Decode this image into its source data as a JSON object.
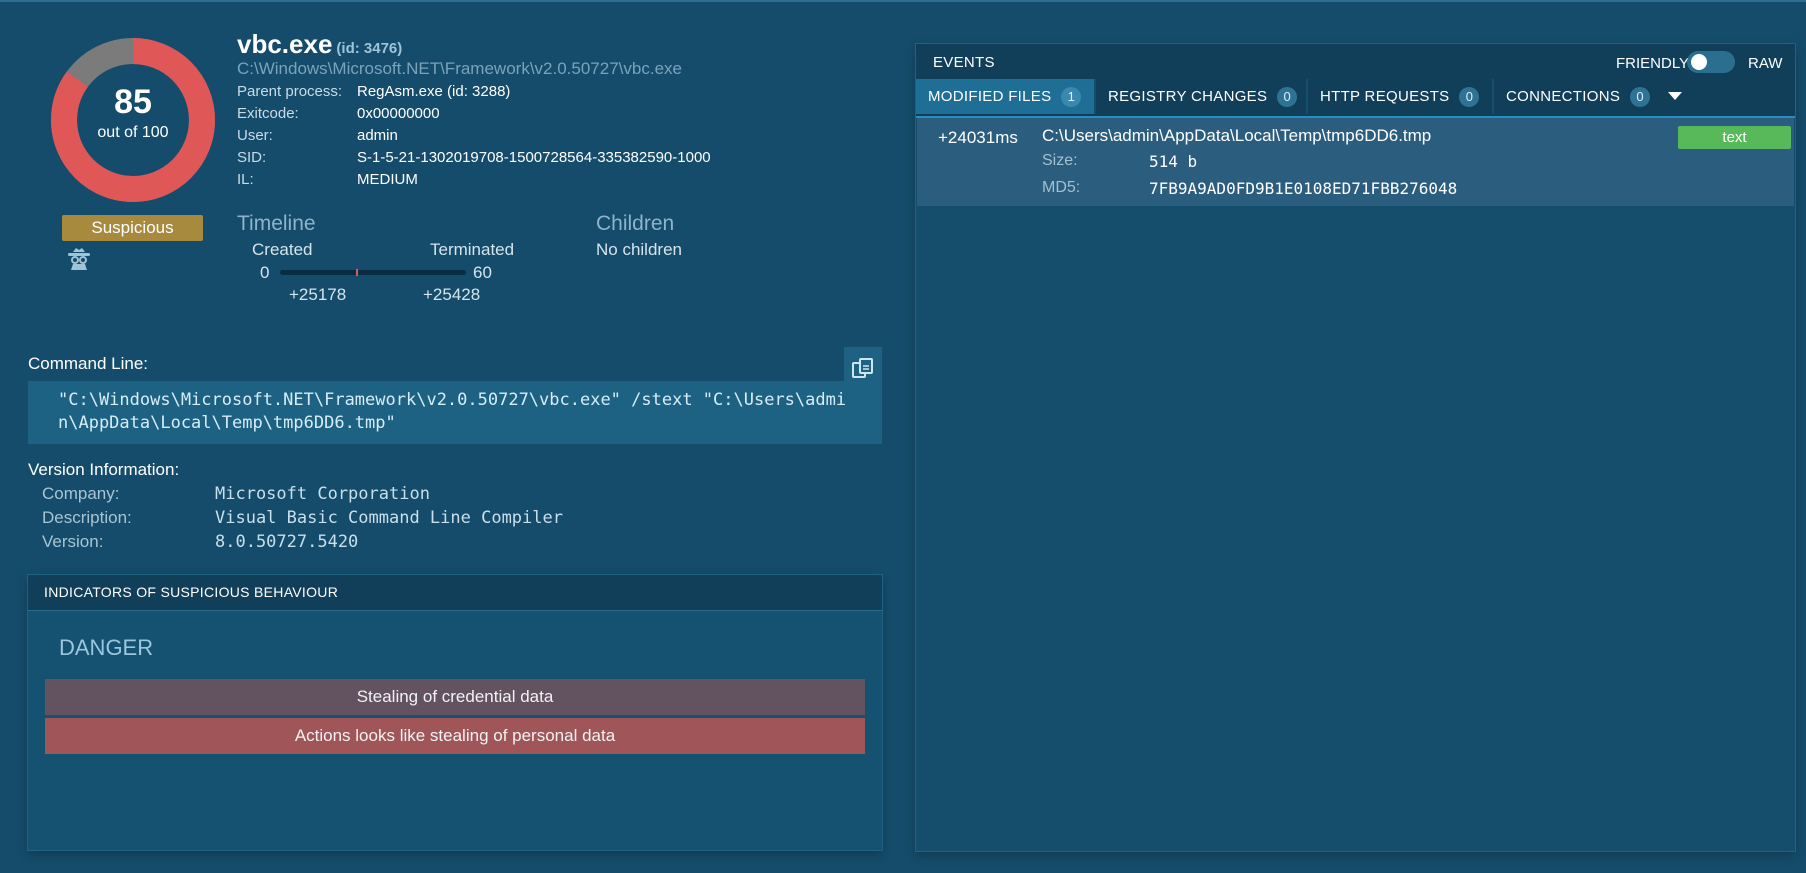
{
  "process": {
    "name": "vbc.exe",
    "id_label": "(id: 3476)",
    "path": "C:\\Windows\\Microsoft.NET\\Framework\\v2.0.50727\\vbc.exe",
    "info": [
      {
        "key": "Parent process:",
        "value": "RegAsm.exe (id: 3288)"
      },
      {
        "key": "Exitcode:",
        "value": "0x00000000"
      },
      {
        "key": "User:",
        "value": "admin"
      },
      {
        "key": "SID:",
        "value": "S-1-5-21-1302019708-1500728564-335382590-1000"
      },
      {
        "key": "IL:",
        "value": "MEDIUM"
      }
    ]
  },
  "score": {
    "value": "85",
    "out_of_label": "out of 100",
    "fraction": 0.85,
    "verdict": "Suspicious",
    "colors": {
      "danger": "#e05757",
      "rest": "#7b7b7b",
      "verdict": "#a88a3f"
    }
  },
  "timeline": {
    "title": "Timeline",
    "created_label": "Created",
    "terminated_label": "Terminated",
    "start": "0",
    "end": "60",
    "created_time": "+25178",
    "terminated_time": "+25428"
  },
  "children": {
    "title": "Children",
    "text": "No children"
  },
  "command_line": {
    "label": "Command Line:",
    "text": "\"C:\\Windows\\Microsoft.NET\\Framework\\v2.0.50727\\vbc.exe\" /stext \"C:\\Users\\admin\\AppData\\Local\\Temp\\tmp6DD6.tmp\""
  },
  "version": {
    "label": "Version Information:",
    "rows": [
      {
        "key": "Company:",
        "value": "Microsoft Corporation"
      },
      {
        "key": "Description:",
        "value": "Visual Basic Command Line Compiler"
      },
      {
        "key": "Version:",
        "value": "8.0.50727.5420"
      }
    ]
  },
  "indicators": {
    "title": "INDICATORS OF SUSPICIOUS BEHAVIOUR",
    "group": "DANGER",
    "items": [
      {
        "text": "Stealing of credential data",
        "color": "#63525f"
      },
      {
        "text": "Actions looks like stealing of personal data",
        "color": "#a05559"
      }
    ]
  },
  "events": {
    "title": "EVENTS",
    "mode_friendly": "FRIENDLY",
    "mode_raw": "RAW",
    "tabs": [
      {
        "label": "MODIFIED FILES",
        "count": "1"
      },
      {
        "label": "REGISTRY CHANGES",
        "count": "0"
      },
      {
        "label": "HTTP REQUESTS",
        "count": "0"
      },
      {
        "label": "CONNECTIONS",
        "count": "0"
      }
    ],
    "rows": [
      {
        "time": "+24031ms",
        "path": "C:\\Users\\admin\\AppData\\Local\\Temp\\tmp6DD6.tmp",
        "size_label": "Size:",
        "size": "514 b",
        "md5_label": "MD5:",
        "md5": "7FB9A9AD0FD9B1E0108ED71FBB276048",
        "type": "text"
      }
    ]
  }
}
